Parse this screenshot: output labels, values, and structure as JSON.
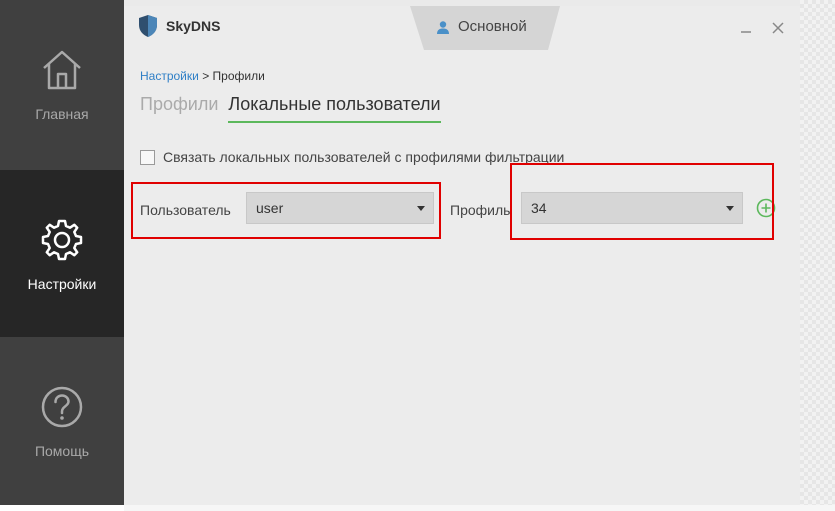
{
  "sidebar": {
    "items": [
      {
        "label": "Главная",
        "icon": "home-icon"
      },
      {
        "label": "Настройки",
        "icon": "gear-icon",
        "active": true
      },
      {
        "label": "Помощь",
        "icon": "help-icon"
      }
    ]
  },
  "header": {
    "app_name": "SkyDNS",
    "profile_tab": "Основной"
  },
  "breadcrumb": {
    "root": "Настройки",
    "separator": ">",
    "current": "Профили"
  },
  "subtabs": [
    {
      "label": "Профили",
      "active": false
    },
    {
      "label": "Локальные пользователи",
      "active": true
    }
  ],
  "link_checkbox": {
    "label": "Связать локальных пользователей с профилями фильтрации",
    "checked": false
  },
  "user_field": {
    "label": "Пользователь",
    "value": "user"
  },
  "profile_field": {
    "label": "Профиль",
    "value": "34"
  },
  "colors": {
    "sidebar": "#404040",
    "sidebar_active": "#262626",
    "accent_green": "#5cb85c",
    "link_blue": "#2f7fc6",
    "annotation_red": "#e00000"
  }
}
